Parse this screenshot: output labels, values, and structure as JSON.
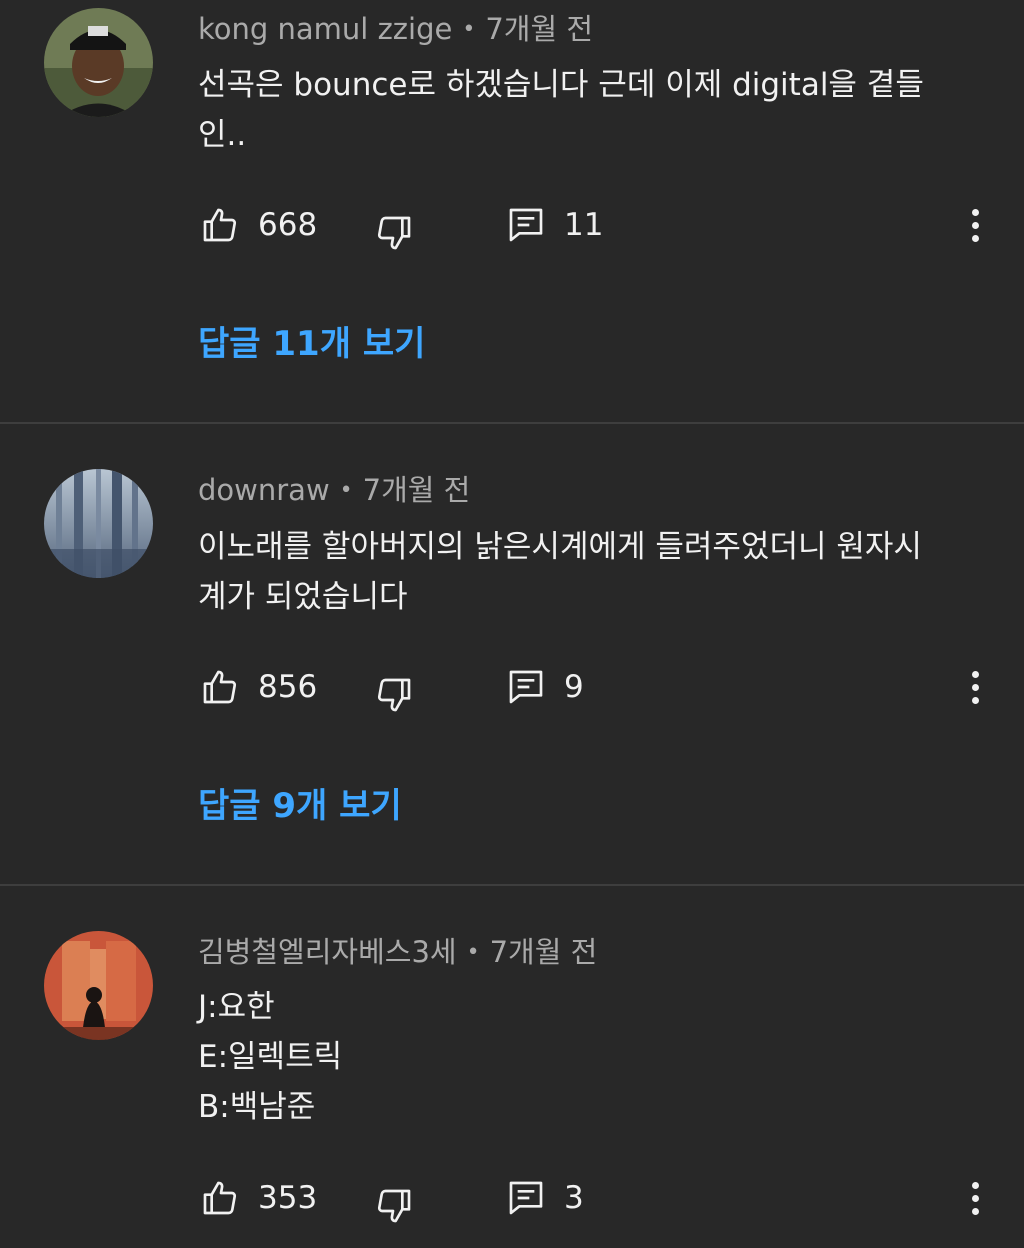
{
  "comments": [
    {
      "author": "kong namul zzige",
      "separator": "•",
      "time": "7개월 전",
      "lines": [
        "선곡은 bounce로 하겠습니다 근데 이제 digital을 곁들",
        "인.."
      ],
      "likes": "668",
      "reply_count": "11",
      "view_replies": "답글 11개 보기",
      "avatar_icon": "person-avatar-icon"
    },
    {
      "author": "downraw",
      "separator": "•",
      "time": "7개월 전",
      "lines": [
        "이노래를 할아버지의 낡은시계에게 들려주었더니 원자시",
        "계가 되었습니다"
      ],
      "likes": "856",
      "reply_count": "9",
      "view_replies": "답글 9개 보기",
      "avatar_icon": "forest-avatar-icon"
    },
    {
      "author": "김병철엘리자베스3세",
      "separator": "•",
      "time": "7개월 전",
      "lines": [
        "J:요한",
        "E:일렉트릭",
        "B:백남준"
      ],
      "likes": "353",
      "reply_count": "3",
      "avatar_icon": "silhouette-avatar-icon"
    }
  ],
  "icons": {
    "like": "thumbs-up-icon",
    "dislike": "thumbs-down-icon",
    "reply": "comment-icon",
    "more": "more-vert-icon"
  },
  "colors": {
    "background": "#282828",
    "link": "#3ea6ff",
    "secondary_text": "#aaaaaa",
    "primary_text": "#f1f1f1"
  }
}
